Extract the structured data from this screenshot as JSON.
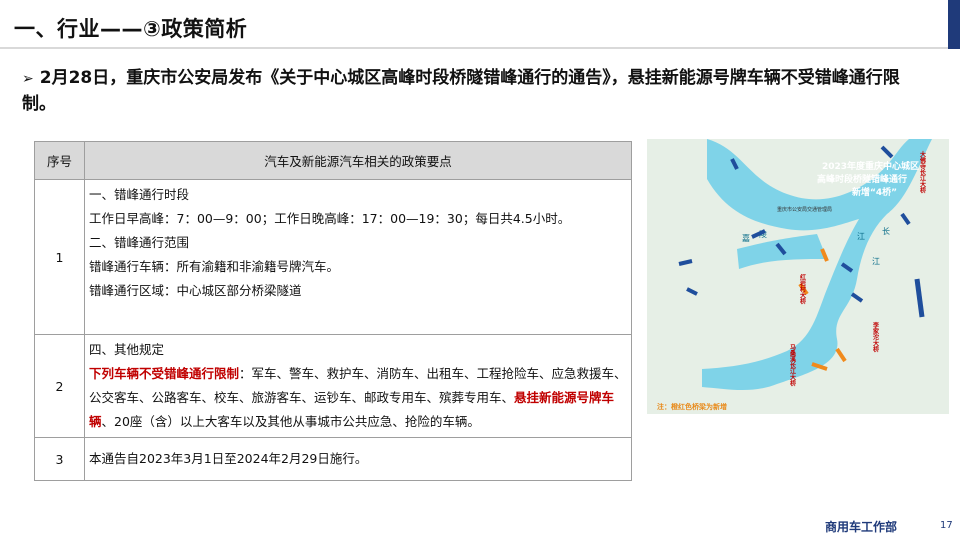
{
  "header": {
    "title": "一、行业——③政策简析"
  },
  "headline": {
    "arrow": "➢",
    "text": "2月28日，重庆市公安局发布《关于中心城区高峰时段桥隧错峰通行的通告》，悬挂新能源号牌车辆不受错峰通行限制。"
  },
  "table": {
    "headers": [
      "序号",
      "汽车及新能源汽车相关的政策要点"
    ],
    "rows": [
      {
        "num": "1",
        "lines": [
          "一、错峰通行时段",
          "工作日早高峰：7：00—9：00；工作日晚高峰：17：00—19：30；每日共4.5小时。",
          "二、错峰通行范围",
          "错峰通行车辆：所有渝籍和非渝籍号牌汽车。",
          "错峰通行区域：中心城区部分桥梁隧道"
        ]
      },
      {
        "num": "2",
        "line1": "四、其他规定",
        "red1": "下列车辆不受错峰通行限制",
        "text1": "：军车、警车、救护车、消防车、出租车、工程抢险车、应急救援车、公交客车、公路客车、校车、旅游客车、运钞车、邮政专用车、殡葬专用车、",
        "red2": "悬挂新能源号牌车辆",
        "text2": "、20座（含）以上大客车以及其他从事城市公共应急、抢险的车辆。"
      },
      {
        "num": "3",
        "text": "本通告自2023年3月1日至2024年2月29日施行。"
      }
    ]
  },
  "map": {
    "title1": "2023年度重庆中心城区",
    "title2": "高峰时段桥隧错峰通行",
    "title3": "新增“4桥”",
    "agency": "重庆市公安局交通管理局",
    "note": "注：橙红色桥梁为新增",
    "labels": {
      "b1": "大佛寺长江大桥",
      "b2": "红岩村大桥",
      "b3": "李家沱大桥",
      "b4": "马桑溪长江大桥",
      "r1": "嘉",
      "r2": "陵",
      "r3": "江",
      "r4": "长",
      "r5": "江"
    },
    "colors": {
      "water": "#7fd3e8",
      "land": "#e6efe6",
      "old_bridge": "#1f4e9c",
      "new_bridge": "#f08a1c",
      "note": "#e88a1a"
    }
  },
  "footer": {
    "dept": "商用车工作部",
    "page": "17"
  }
}
